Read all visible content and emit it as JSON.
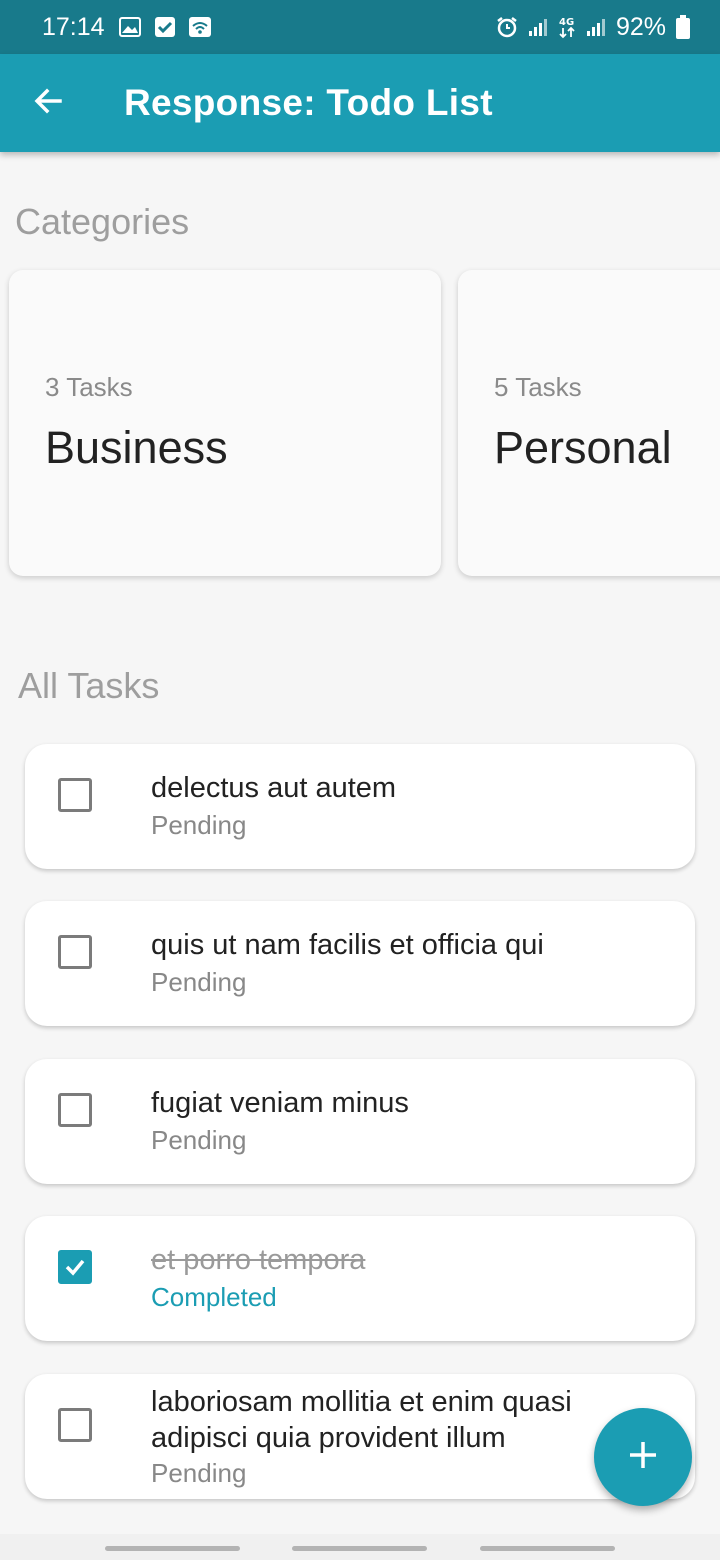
{
  "status_bar": {
    "time": "17:14",
    "battery": "92%",
    "icons": [
      "gallery-icon",
      "check-icon",
      "wifi-icon",
      "alarm-icon",
      "signal-icon",
      "4g-icon",
      "signal-icon",
      "battery-icon"
    ]
  },
  "app_bar": {
    "title": "Response: Todo List",
    "back_icon": "arrow-left-icon"
  },
  "categories": {
    "title": "Categories",
    "items": [
      {
        "count": "3 Tasks",
        "name": "Business"
      },
      {
        "count": "5 Tasks",
        "name": "Personal"
      }
    ]
  },
  "all_tasks": {
    "title": "All Tasks",
    "items": [
      {
        "title": "delectus aut autem",
        "status": "Pending",
        "completed": false
      },
      {
        "title": "quis ut nam facilis et officia qui",
        "status": "Pending",
        "completed": false
      },
      {
        "title": "fugiat veniam minus",
        "status": "Pending",
        "completed": false
      },
      {
        "title": "et porro tempora",
        "status": "Completed",
        "completed": true
      },
      {
        "title": "laboriosam mollitia et enim quasi adipisci quia provident illum",
        "status": "Pending",
        "completed": false
      }
    ]
  },
  "fab": {
    "icon": "plus-icon"
  },
  "colors": {
    "primary": "#1b9db3",
    "status_bar": "#187a8b"
  }
}
